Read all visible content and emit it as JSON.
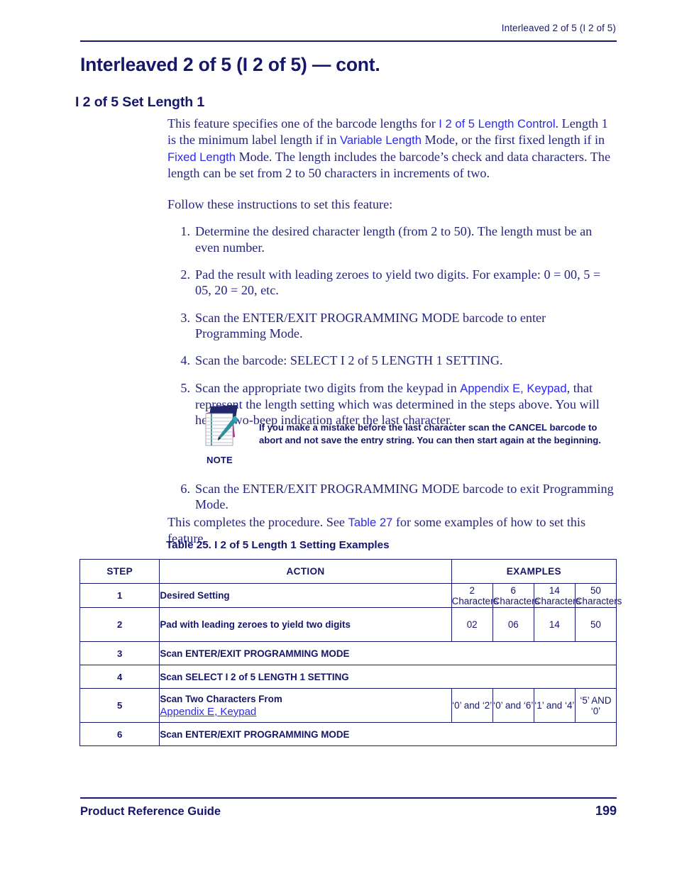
{
  "page": {
    "running_header": "Interleaved 2 of 5 (I 2 of 5)",
    "heading": "Interleaved 2 of 5 (I 2 of 5) — cont.",
    "subheading": "I 2 of 5 Set Length 1",
    "colors": {
      "text_navy": "#252580",
      "heading_navy": "#16166b",
      "link_blue": "#2b2bf0",
      "rule_navy": "#1a1a6e",
      "icon_cover": "#23276b",
      "icon_spine": "#c0268f",
      "icon_pen": "#2f8f9b"
    }
  },
  "intro": {
    "para1_part1": "This feature specifies one of the barcode lengths for ",
    "link_length_control": "I 2 of 5 Length Control",
    "para1_part2": ". Length 1 is the minimum label length if in ",
    "link_variable_length": "Variable Length",
    "para1_part3": " Mode, or the first fixed length if in ",
    "link_fixed_length": "Fixed Length",
    "para1_part4": " Mode. The length includes the barcode’s check and data characters. The length can be set from 2 to 50 characters in increments of two.",
    "para2": "Follow these instructions to set this feature:"
  },
  "steps": [
    {
      "num": "1.",
      "text": "Determine the desired character length (from 2 to 50). The length must be an even number."
    },
    {
      "num": "2.",
      "text": "Pad the result with leading zeroes to yield two digits. For example: 0 = 00, 5 = 05, 20 = 20, etc."
    },
    {
      "num": "3.",
      "text": "Scan the ENTER/EXIT PROGRAMMING MODE barcode to enter Programming Mode."
    },
    {
      "num": "4.",
      "text": "Scan the barcode: SELECT I 2 of 5 LENGTH 1 SETTING."
    },
    {
      "num": "5.",
      "text_part1": "Scan the appropriate two digits from the keypad in ",
      "link_appendix": "Appendix E, Keypad",
      "text_part2": ", that represent the length setting which was determined in the steps above. You will hear a two-beep indication after the last character."
    }
  ],
  "note": {
    "label": "NOTE",
    "icon": "notepad-pencil-icon",
    "text": "If you make a mistake before the last character scan the CANCEL barcode to abort and not save the entry string. You can then start again at the beginning."
  },
  "step6": {
    "num": "6.",
    "text": "Scan the ENTER/EXIT PROGRAMMING MODE barcode to exit Programming Mode."
  },
  "closing": {
    "part1": "This completes the procedure. See ",
    "link_table27": "Table 27",
    "part2": " for some examples of how to set this feature."
  },
  "table": {
    "caption": "Table 25. I 2 of 5 Length 1 Setting Examples",
    "headers": {
      "step": "STEP",
      "action": "ACTION",
      "examples": "EXAMPLES"
    },
    "rows": [
      {
        "step": "1",
        "action": "Desired Setting",
        "examples": [
          "2 Characters",
          "6 Characters",
          "14 Characters",
          "50 Characters"
        ]
      },
      {
        "step": "2",
        "action": "Pad with leading zeroes to yield two digits",
        "examples": [
          "02",
          "06",
          "14",
          "50"
        ]
      },
      {
        "step": "3",
        "action": "Scan ENTER/EXIT PROGRAMMING MODE",
        "span": true
      },
      {
        "step": "4",
        "action": "Scan SELECT I 2 of 5 LENGTH 1 SETTING",
        "span": true
      },
      {
        "step": "5",
        "action": "Scan Two Characters From",
        "action_link": "Appendix E, Keypad",
        "examples": [
          "‘0’ and ‘2’",
          "‘0’ and ‘6’",
          "‘1’ and ‘4’",
          "‘5’ AND ‘0’"
        ]
      },
      {
        "step": "6",
        "action": "Scan ENTER/EXIT PROGRAMMING MODE",
        "span": true
      }
    ]
  },
  "footer": {
    "title": "Product Reference Guide",
    "page_number": "199"
  }
}
